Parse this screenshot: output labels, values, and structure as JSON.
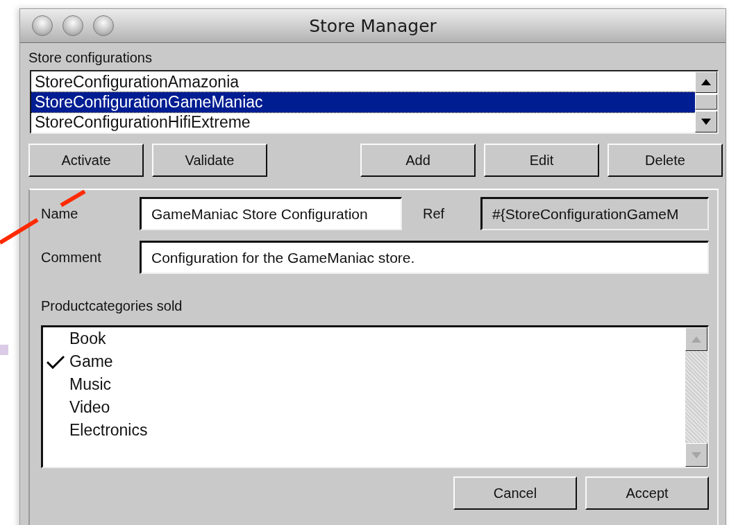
{
  "window": {
    "title": "Store Manager"
  },
  "configurations": {
    "label": "Store configurations",
    "items": [
      {
        "label": "StoreConfigurationAmazonia",
        "selected": false
      },
      {
        "label": "StoreConfigurationGameManiac",
        "selected": true
      },
      {
        "label": "StoreConfigurationHifiExtreme",
        "selected": false
      }
    ]
  },
  "config_buttons": {
    "left": [
      "Activate",
      "Validate"
    ],
    "right": [
      "Add",
      "Edit",
      "Delete"
    ]
  },
  "form": {
    "name": {
      "label": "Name",
      "value": "GameManiac Store Configuration"
    },
    "ref": {
      "label": "Ref",
      "value": "#{StoreConfigurationGameM",
      "disabled": true
    },
    "comment": {
      "label": "Comment",
      "value": "Configuration for the GameManiac store."
    }
  },
  "categories": {
    "label": "Productcategories sold",
    "items": [
      {
        "label": "Book",
        "checked": false
      },
      {
        "label": "Game",
        "checked": true
      },
      {
        "label": "Music",
        "checked": false
      },
      {
        "label": "Video",
        "checked": false
      },
      {
        "label": "Electronics",
        "checked": false
      }
    ]
  },
  "dialog_buttons": [
    "Cancel",
    "Accept"
  ]
}
